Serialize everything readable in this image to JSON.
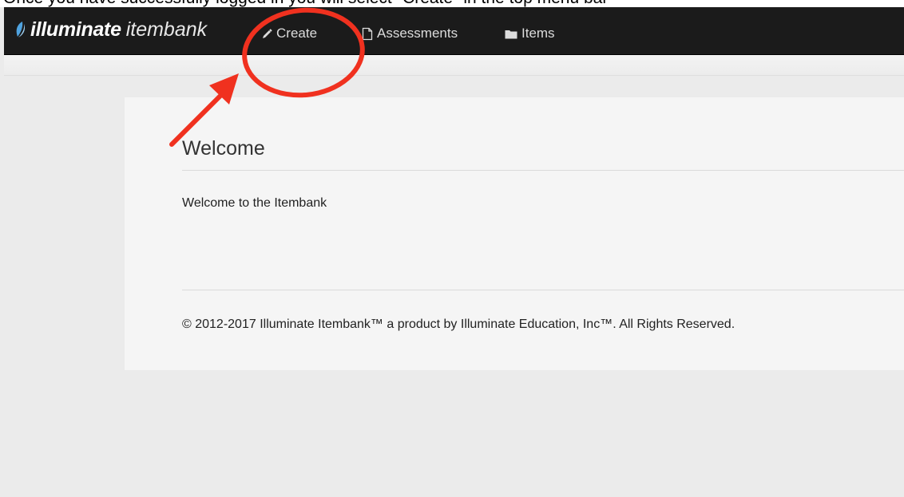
{
  "caption": "Once you have successfully logged in you will select \"Create\" in the top menu bar",
  "brand": {
    "name_bold": "illuminate",
    "name_light": "itembank"
  },
  "nav": {
    "items": [
      {
        "label": "Create",
        "icon": "pencil-icon"
      },
      {
        "label": "Assessments",
        "icon": "document-icon"
      },
      {
        "label": "Items",
        "icon": "folder-icon"
      }
    ]
  },
  "main": {
    "title": "Welcome",
    "text": "Welcome to the Itembank",
    "footer": "© 2012-2017 Illuminate Itembank™ a product by Illuminate Education, Inc™. All Rights Reserved."
  },
  "colors": {
    "navbar": "#1b1b1b",
    "page_background": "#ebebeb",
    "card_background": "#f5f5f5",
    "annotation_red": "#f0311f",
    "brand_blue": "#4fa3e0"
  }
}
